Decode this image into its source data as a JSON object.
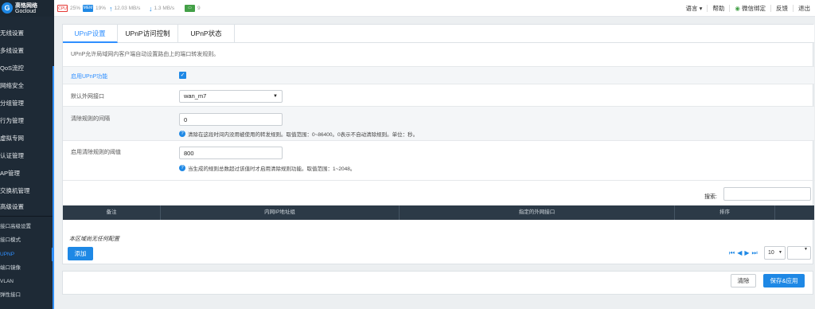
{
  "brand": {
    "name_cn": "高恪网络",
    "name_en": "Gocloud"
  },
  "stats": {
    "cpu": "25%",
    "memory": "19%",
    "upload": "12.03 MB/s",
    "download": "1.3 MB/s",
    "terminals": "9"
  },
  "toplinks": [
    "语言 ▾",
    "帮助",
    "微信绑定",
    "反馈",
    "退出"
  ],
  "sidebar": {
    "items": [
      "无线设置",
      "多线设置",
      "QoS流控",
      "网络安全",
      "分组管理",
      "行为管理",
      "虚拟专网",
      "认证管理",
      "AP管理",
      "交换机管理",
      "高级设置"
    ],
    "subitems": [
      "接口高级设置",
      "接口模式",
      "UPNP",
      "端口镜像",
      "VLAN",
      "弹性接口"
    ],
    "active_sub": "UPNP"
  },
  "tabs": [
    "UPnP设置",
    "UPnP访问控制",
    "UPnP状态"
  ],
  "description": "UPnP允许局域网内客户端自动设置路由上的端口转发规则。",
  "form": {
    "enable_label": "启用UPnP功能",
    "enable_checked": true,
    "wan_label": "默认外网接口",
    "wan_value": "wan_m7",
    "interval_label": "清除规则的间隔",
    "interval_value": "0",
    "interval_hint": "清除在这段时间内没用被使用的转发规则。取值范围：0~86400。0表示不自动清除规则。单位：秒。",
    "threshold_label": "启用清除规则的阈值",
    "threshold_value": "800",
    "threshold_hint": "当生成的规则总数超过该值时才启用清除规则功能。取值范围：1~2048。"
  },
  "table": {
    "search_label": "搜索:",
    "columns": [
      "备注",
      "内网IP地址组",
      "指定的外网接口",
      "排序"
    ],
    "empty_text": "本区域尚无任何配置",
    "add_label": "添加",
    "page_size": "10"
  },
  "footer": {
    "clear_label": "清除",
    "save_label": "保存&应用"
  },
  "colors": {
    "accent": "#1e88e5",
    "sidebar": "#1e2a36",
    "table_header": "#2c3a47"
  }
}
